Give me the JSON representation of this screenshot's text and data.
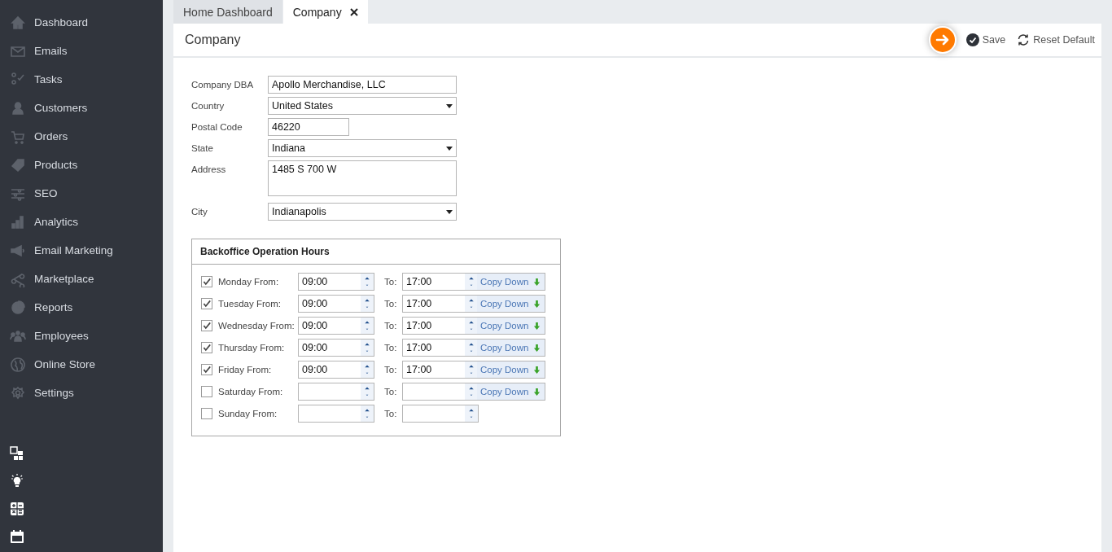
{
  "sidebar": {
    "items": [
      {
        "label": "Dashboard"
      },
      {
        "label": "Emails"
      },
      {
        "label": "Tasks"
      },
      {
        "label": "Customers"
      },
      {
        "label": "Orders"
      },
      {
        "label": "Products"
      },
      {
        "label": "SEO"
      },
      {
        "label": "Analytics"
      },
      {
        "label": "Email Marketing"
      },
      {
        "label": "Marketplace"
      },
      {
        "label": "Reports"
      },
      {
        "label": "Employees"
      },
      {
        "label": "Online Store"
      },
      {
        "label": "Settings"
      }
    ]
  },
  "tabs": [
    {
      "label": "Home Dashboard",
      "selected": false,
      "closable": false
    },
    {
      "label": "Company",
      "selected": true,
      "closable": true
    }
  ],
  "page": {
    "title": "Company",
    "actions": [
      {
        "label": "Save",
        "kind": "save"
      },
      {
        "label": "Reset Default",
        "kind": "reset"
      }
    ]
  },
  "form": {
    "fields": [
      {
        "label": "Company DBA",
        "kind": "text",
        "value": "Apollo Merchandise, LLC"
      },
      {
        "label": "Country",
        "kind": "select",
        "value": "United States"
      },
      {
        "label": "Postal Code",
        "kind": "short",
        "value": "46220"
      },
      {
        "label": "State",
        "kind": "select",
        "value": "Indiana"
      },
      {
        "label": "Address",
        "kind": "textarea",
        "value": "1485 S 700 W"
      },
      {
        "label": "City",
        "kind": "select",
        "value": "Indianapolis"
      }
    ]
  },
  "hours": {
    "title": "Backoffice Operation Hours",
    "rows": [
      {
        "label": "Monday From:",
        "checked": true,
        "from": "09:00",
        "to_label": "To:",
        "to": "17:00",
        "copy_label": "Copy Down"
      },
      {
        "label": "Tuesday From:",
        "checked": true,
        "from": "09:00",
        "to_label": "To:",
        "to": "17:00",
        "copy_label": "Copy Down"
      },
      {
        "label": "Wednesday From:",
        "checked": true,
        "from": "09:00",
        "to_label": "To:",
        "to": "17:00",
        "copy_label": "Copy Down"
      },
      {
        "label": "Thursday From:",
        "checked": true,
        "from": "09:00",
        "to_label": "To:",
        "to": "17:00",
        "copy_label": "Copy Down"
      },
      {
        "label": "Friday From:",
        "checked": true,
        "from": "09:00",
        "to_label": "To:",
        "to": "17:00",
        "copy_label": "Copy Down"
      },
      {
        "label": "Saturday From:",
        "checked": false,
        "to_label": "To:",
        "copy_label": "Copy Down"
      },
      {
        "label": "Sunday From:",
        "checked": false,
        "to_label": "To:"
      }
    ]
  }
}
